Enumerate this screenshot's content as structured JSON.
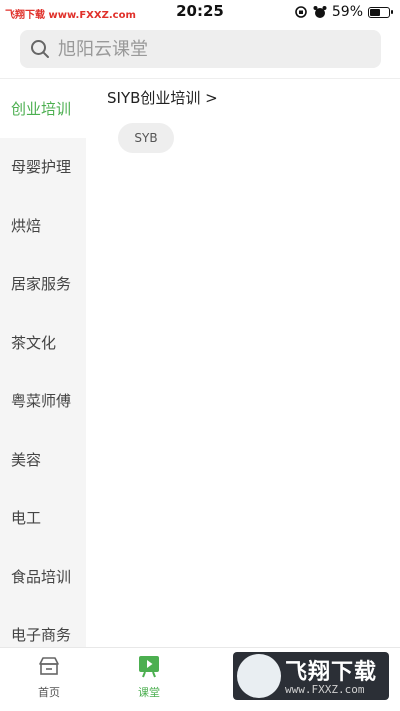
{
  "status_bar": {
    "watermark_text": "飞翔下载 www.FXXZ.com",
    "time": "20:25",
    "battery_percent_text": "59%",
    "battery_level": 0.59
  },
  "search": {
    "placeholder": "旭阳云课堂"
  },
  "sidebar": {
    "items": [
      {
        "label": "创业培训",
        "active": true
      },
      {
        "label": "母婴护理"
      },
      {
        "label": "烘焙"
      },
      {
        "label": "居家服务"
      },
      {
        "label": "茶文化"
      },
      {
        "label": "粤菜师傅"
      },
      {
        "label": "美容"
      },
      {
        "label": "电工"
      },
      {
        "label": "食品培训"
      },
      {
        "label": "电子商务"
      }
    ]
  },
  "content": {
    "section_title": "SIYB创业培训 >",
    "chips": [
      "SYB"
    ]
  },
  "tabbar": {
    "home_label": "首页",
    "course_label": "课堂"
  },
  "watermark": {
    "brand": "飞翔下载",
    "url": "www.FXXZ.com"
  },
  "colors": {
    "accent": "#4caf50",
    "sidebar_bg": "#f5f5f5",
    "search_bg": "#eeeeee"
  }
}
